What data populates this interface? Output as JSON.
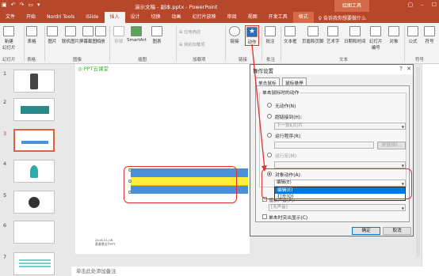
{
  "window": {
    "title": "演示文稿 - 副本.pptx  -  PowerPoint",
    "context_tool": "绘图工具"
  },
  "tabs": [
    "文件",
    "开始",
    "Nordri Tools",
    "iSlide",
    "插入",
    "设计",
    "切换",
    "动画",
    "幻灯片放映",
    "审阅",
    "视图",
    "开发工具",
    "格式"
  ],
  "active_tab": "插入",
  "tell_me": "♀ 告诉我你想要做什么",
  "ribbon": {
    "buttons": [
      {
        "label": "新建",
        "sub": "幻灯片"
      },
      {
        "label": "表格"
      },
      {
        "label": "图片"
      },
      {
        "label": "联机图片"
      },
      {
        "label": "屏幕截图"
      },
      {
        "label": "相册"
      },
      {
        "label": "形状"
      },
      {
        "label": "SmartArt"
      },
      {
        "label": "图表"
      },
      {
        "label": "链接"
      },
      {
        "label": "动作"
      },
      {
        "label": "批注"
      },
      {
        "label": "文本框"
      },
      {
        "label": "页眉和页脚"
      },
      {
        "label": "艺术字"
      },
      {
        "label": "日期和时间"
      },
      {
        "label": "幻灯片",
        "sub": "编号"
      },
      {
        "label": "对象"
      },
      {
        "label": "公式"
      },
      {
        "label": "符号"
      }
    ],
    "addins": [
      "应用商店",
      "我的加载项"
    ],
    "groups": [
      "幻灯片",
      "表格",
      "图像",
      "插图",
      "加载项",
      "链接",
      "批注",
      "文本",
      "符号"
    ]
  },
  "thumbnails": {
    "numbers": [
      "1",
      "2",
      "3",
      "4",
      "5",
      "6",
      "7"
    ],
    "selected": "3"
  },
  "slide": {
    "logo": "PPT云课堂",
    "date_line1": "2016-01-08",
    "date_line2": "客道德出不PPT"
  },
  "notes": "单击此处添加备注",
  "dialog": {
    "title": "操作设置",
    "help": "?",
    "close": "✕",
    "tabs": [
      "单击鼠标",
      "鼠标悬停"
    ],
    "group_title": "单击鼠标时的动作",
    "options": {
      "none": "无动作(N)",
      "hyperlink": "超链接到(H):",
      "hyperlink_value": "下一张幻灯片",
      "run_program": "运行程序(R):",
      "browse": "浏览(B)...",
      "run_macro": "运行宏(M):",
      "object_action": "对象动作(A):",
      "object_value": "编辑(E)"
    },
    "dropdown_options": [
      "编辑(E)",
      "打开(O)"
    ],
    "play_sound": "播放声音(P):",
    "sound_value": "[无声音]",
    "highlight": "单击时突出显示(C)",
    "ok": "确定",
    "cancel": "取消"
  }
}
